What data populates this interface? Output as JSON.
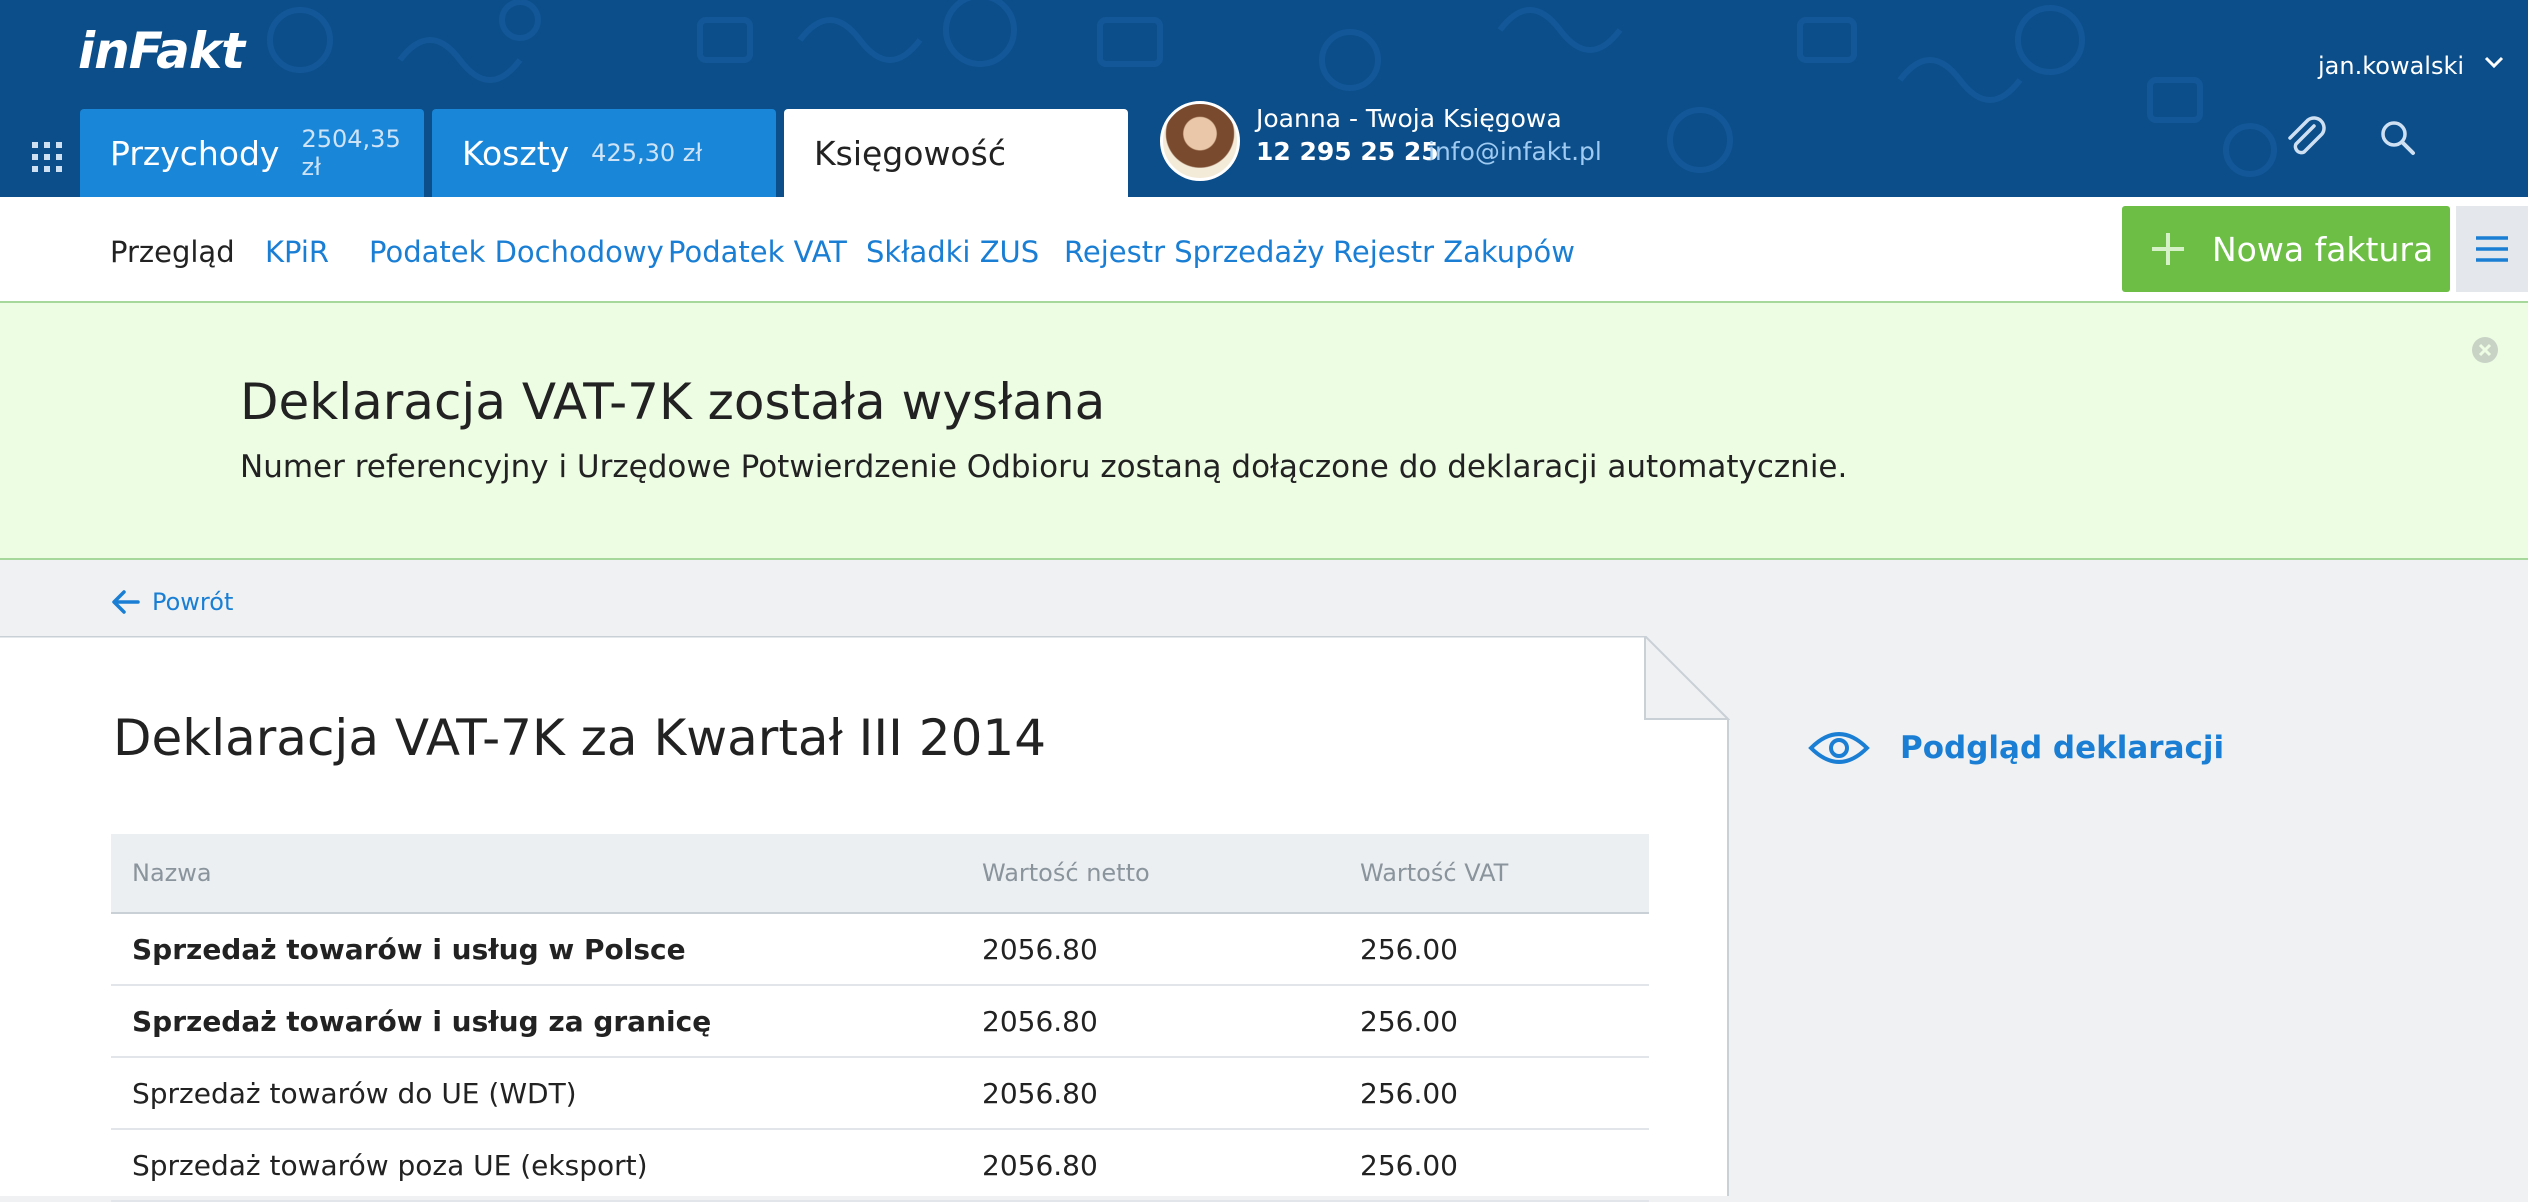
{
  "header": {
    "logo": "inFakt",
    "tabs": [
      {
        "label": "Przychody",
        "amount": "2504,35 zł"
      },
      {
        "label": "Koszty",
        "amount": "425,30 zł"
      },
      {
        "label": "Księgowość"
      }
    ],
    "agent": {
      "name": "Joanna - Twoja Księgowa",
      "phone": "12 295 25 25",
      "email": "info@infakt.pl"
    },
    "user": "jan.kowalski",
    "icons": [
      "apps-grid-icon",
      "chevron-down-icon",
      "paperclip-icon",
      "search-icon"
    ]
  },
  "subnav": {
    "items": [
      "Przegląd",
      "KPiR",
      "Podatek Dochodowy",
      "Podatek VAT",
      "Składki ZUS",
      "Rejestr Sprzedaży",
      "Rejestr Zakupów"
    ],
    "new_invoice": "Nowa faktura"
  },
  "banner": {
    "title": "Deklaracja VAT-7K została wysłana",
    "text": "Numer referencyjny i Urzędowe Potwierdzenie Odbioru zostaną dołączone do deklaracji automatycznie."
  },
  "back": "Powrót",
  "declaration": {
    "title": "Deklaracja VAT-7K za Kwartał III 2014",
    "columns": [
      "Nazwa",
      "Wartość netto",
      "Wartość VAT"
    ],
    "rows": [
      {
        "name": "Sprzedaż towarów i usług w Polsce",
        "net": "2056.80",
        "vat": "256.00"
      },
      {
        "name": "Sprzedaż towarów i usług za granicę",
        "net": "2056.80",
        "vat": "256.00"
      },
      {
        "name": "Sprzedaż towarów do UE (WDT)",
        "net": "2056.80",
        "vat": "256.00"
      },
      {
        "name": "Sprzedaż towarów poza UE (eksport)",
        "net": "2056.80",
        "vat": "256.00"
      }
    ]
  },
  "preview": "Podgląd deklaracji",
  "colors": {
    "header_bg": "#0b4e8a",
    "tab_blue": "#1a86d8",
    "accent_link": "#1a7fd4",
    "primary_button": "#6cbe45",
    "success_bg": "#edfde4",
    "success_border": "#a6d79b"
  }
}
